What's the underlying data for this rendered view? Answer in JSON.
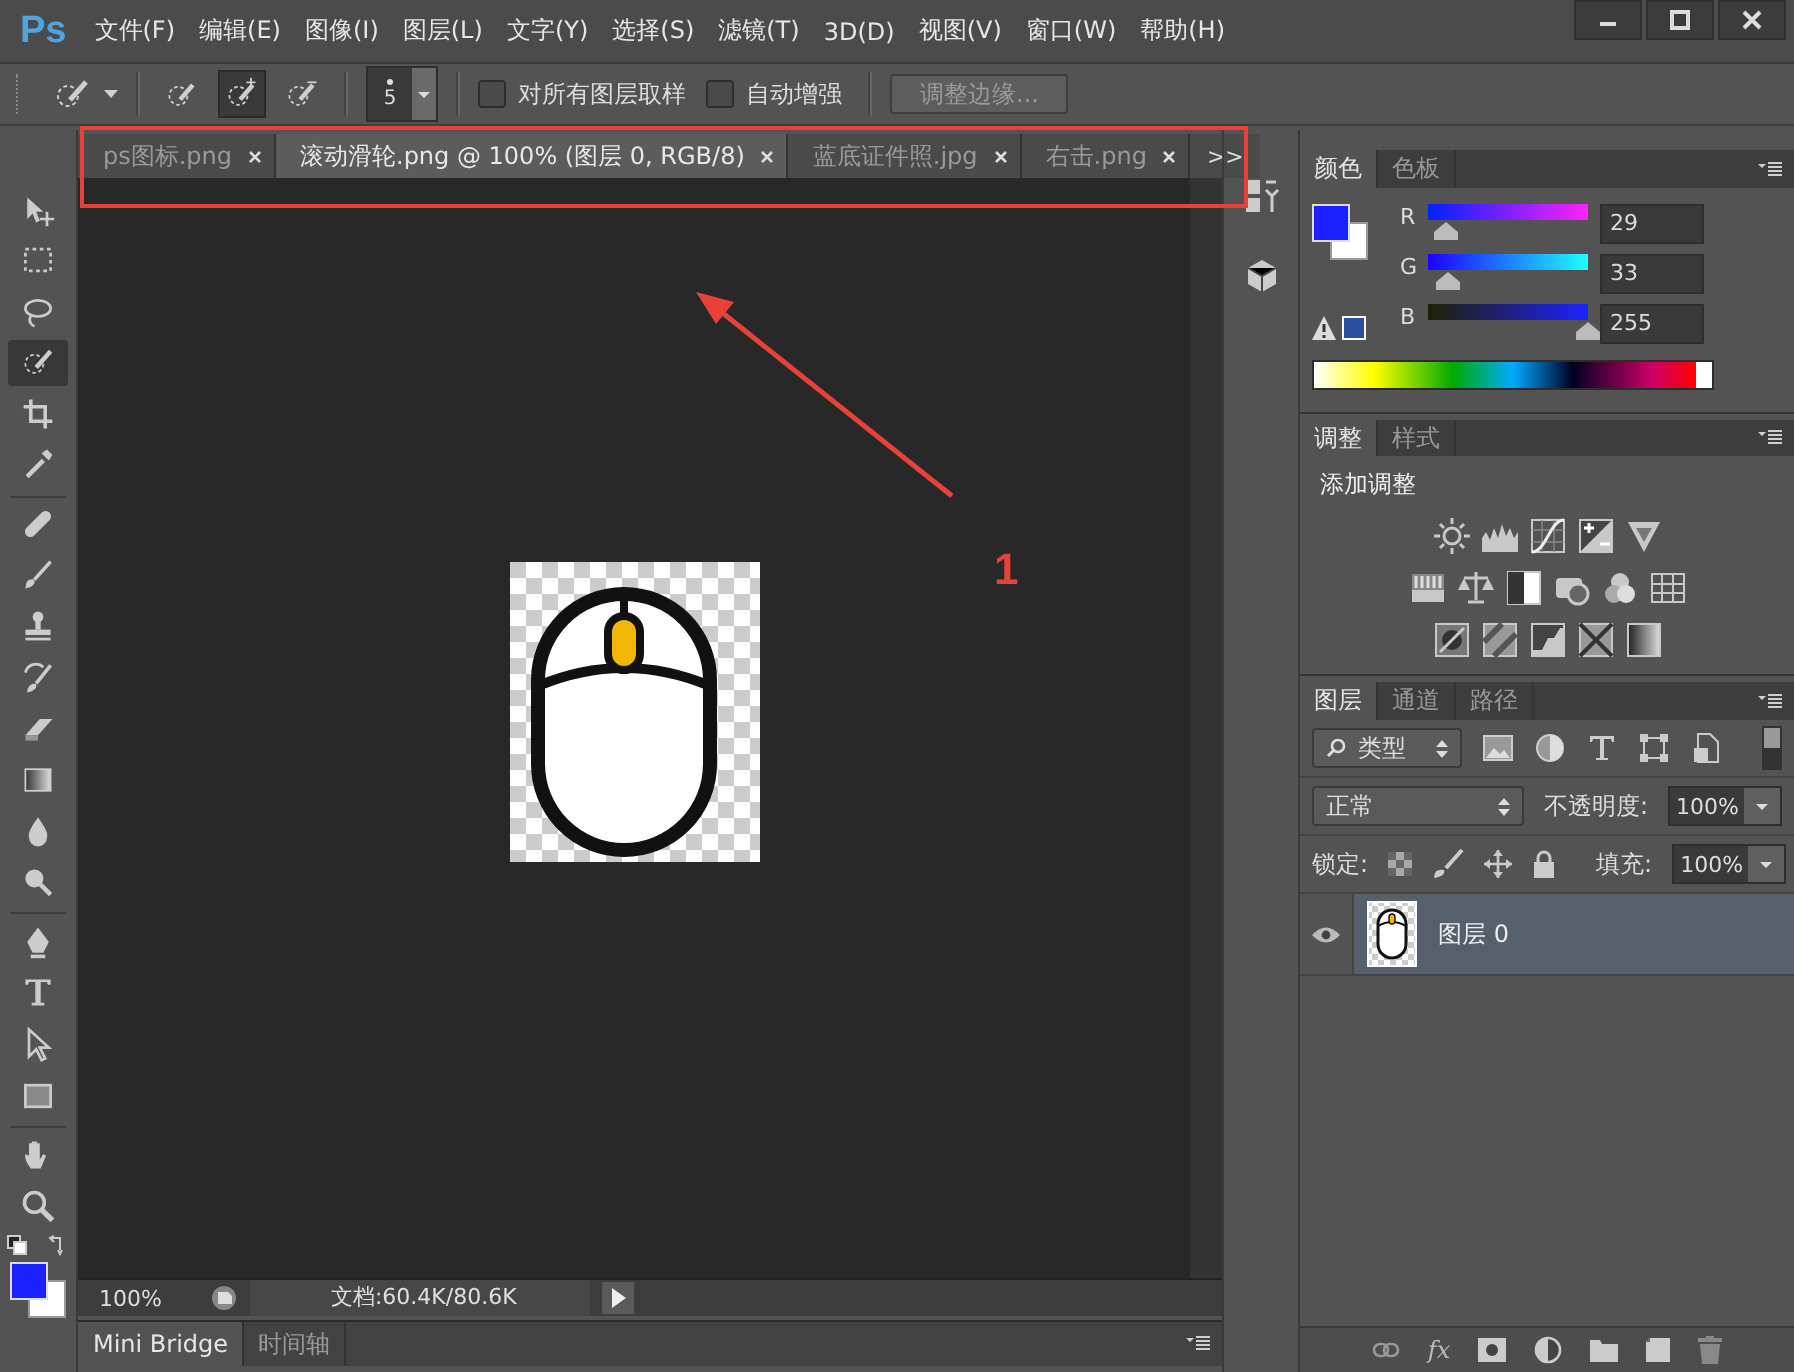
{
  "menubar": {
    "logo": "Ps",
    "menus": [
      "文件(F)",
      "编辑(E)",
      "图像(I)",
      "图层(L)",
      "文字(Y)",
      "选择(S)",
      "滤镜(T)",
      "3D(D)",
      "视图(V)",
      "窗口(W)",
      "帮助(H)"
    ]
  },
  "options_bar": {
    "brush_size": "5",
    "checkboxes": [
      {
        "label": "对所有图层取样",
        "checked": false
      },
      {
        "label": "自动增强",
        "checked": false
      }
    ],
    "refine_button": "调整边缘..."
  },
  "tools": [
    {
      "kind": "move",
      "selected": false
    },
    {
      "kind": "marquee",
      "selected": false
    },
    {
      "kind": "lasso",
      "selected": false
    },
    {
      "kind": "quickselect",
      "selected": true
    },
    {
      "kind": "crop",
      "selected": false
    },
    {
      "kind": "eyedropper",
      "selected": false
    },
    {
      "kind": "healing",
      "selected": false
    },
    {
      "kind": "brush",
      "selected": false
    },
    {
      "kind": "stamp",
      "selected": false
    },
    {
      "kind": "history",
      "selected": false
    },
    {
      "kind": "eraser",
      "selected": false
    },
    {
      "kind": "gradient",
      "selected": false
    },
    {
      "kind": "blur",
      "selected": false
    },
    {
      "kind": "dodge",
      "selected": false
    },
    {
      "kind": "pen",
      "selected": false
    },
    {
      "kind": "type",
      "selected": false
    },
    {
      "kind": "pathselect",
      "selected": false
    },
    {
      "kind": "rect",
      "selected": false
    },
    {
      "kind": "hand",
      "selected": false
    },
    {
      "kind": "zoom",
      "selected": false
    }
  ],
  "document": {
    "tabs": [
      {
        "label": "ps图标.png",
        "selected": false
      },
      {
        "label": "滚动滑轮.png @ 100% (图层 0, RGB/8)",
        "selected": true
      },
      {
        "label": "蓝底证件照.jpg",
        "selected": false
      },
      {
        "label": "右击.png",
        "selected": false
      }
    ],
    "overflow_button": ">>",
    "status": {
      "zoom": "100%",
      "doc_info": "文档:60.4K/80.6K"
    }
  },
  "bottom_panel": {
    "tabs": [
      {
        "label": "Mini Bridge",
        "selected": true
      },
      {
        "label": "时间轴",
        "selected": false
      }
    ]
  },
  "color_panel": {
    "tabs": [
      {
        "label": "颜色",
        "selected": true
      },
      {
        "label": "色板",
        "selected": false
      }
    ],
    "channels": [
      {
        "name": "R",
        "value": "29",
        "level": 0.114
      },
      {
        "name": "G",
        "value": "33",
        "level": 0.129
      },
      {
        "name": "B",
        "value": "255",
        "level": 1
      }
    ]
  },
  "adjustments_panel": {
    "tabs": [
      {
        "label": "调整",
        "selected": true
      },
      {
        "label": "样式",
        "selected": false
      }
    ],
    "title": "添加调整"
  },
  "layers_panel": {
    "tabs": [
      {
        "label": "图层",
        "selected": true
      },
      {
        "label": "通道",
        "selected": false
      },
      {
        "label": "路径",
        "selected": false
      }
    ],
    "filter": "类型",
    "blend_mode": "正常",
    "opacity": {
      "label": "不透明度:",
      "value": "100%"
    },
    "lock_label": "锁定:",
    "fill": {
      "label": "填充:",
      "value": "100%"
    },
    "layers": [
      {
        "name": "图层 0",
        "visible": true,
        "selected": true
      }
    ],
    "effects_button": "fx"
  },
  "annotation": {
    "label": "1"
  }
}
